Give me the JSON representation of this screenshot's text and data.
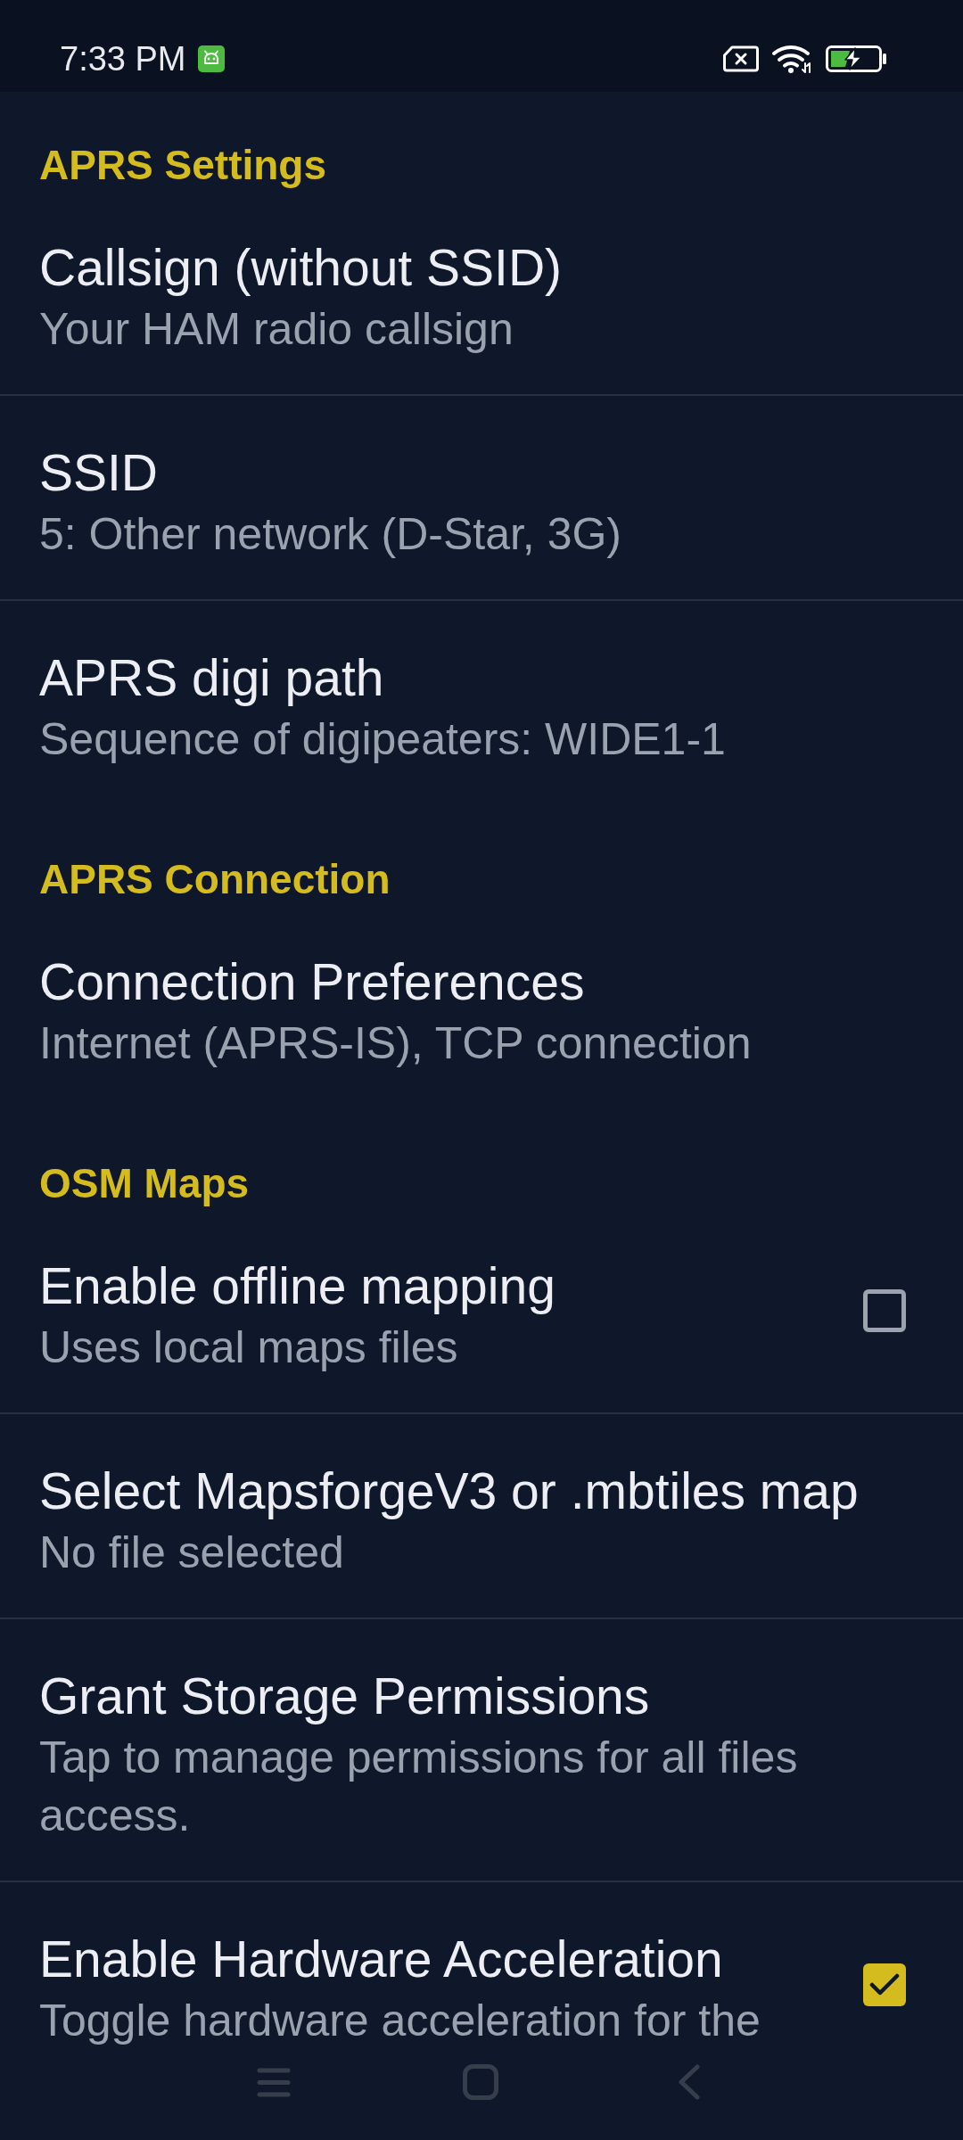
{
  "status_bar": {
    "time": "7:33 PM"
  },
  "sections": [
    {
      "title": "APRS Settings",
      "items": [
        {
          "kind": "text",
          "title": "Callsign (without SSID)",
          "summary": "Your HAM radio callsign"
        },
        {
          "kind": "text",
          "title": "SSID",
          "summary": "5: Other network (D-Star, 3G)"
        },
        {
          "kind": "text",
          "title": "APRS digi path",
          "summary": "Sequence of digipeaters: WIDE1-1"
        }
      ]
    },
    {
      "title": "APRS Connection",
      "items": [
        {
          "kind": "text",
          "title": "Connection Preferences",
          "summary": "Internet (APRS-IS), TCP connection"
        }
      ]
    },
    {
      "title": "OSM Maps",
      "items": [
        {
          "kind": "checkbox",
          "title": "Enable offline mapping",
          "summary": "Uses local maps files",
          "checked": false
        },
        {
          "kind": "text",
          "title": "Select MapsforgeV3 or .mbtiles map",
          "summary": "No file selected"
        },
        {
          "kind": "text",
          "title": "Grant Storage Permissions",
          "summary": "Tap to manage permissions for all files access."
        },
        {
          "kind": "checkbox",
          "title": "Enable Hardware Acceleration",
          "summary": "Toggle hardware acceleration for the",
          "checked": true
        }
      ]
    }
  ]
}
